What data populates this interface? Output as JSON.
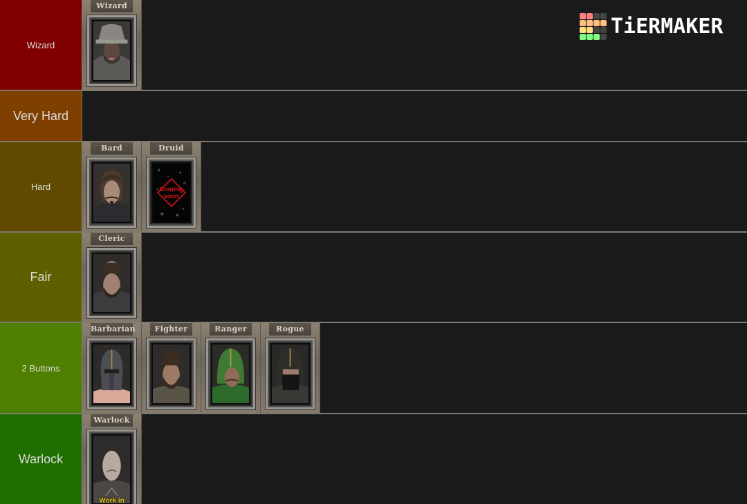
{
  "logo": {
    "text": "TiERMAKER",
    "grid_colors": [
      "#ff7f7f",
      "#ff7f7f",
      "#444444",
      "#444444",
      "#ffbf7f",
      "#ffbf7f",
      "#ffbf7f",
      "#ffbf7f",
      "#ffdf7f",
      "#ffdf7f",
      "#444444",
      "#444444",
      "#7fff7f",
      "#7fff7f",
      "#7fff7f",
      "#444444"
    ]
  },
  "tiers": [
    {
      "label": "Wizard",
      "color": "#800000",
      "items": [
        {
          "name": "Wizard",
          "portrait": "wizard"
        }
      ]
    },
    {
      "label": "Very Hard",
      "color": "#7f3f00",
      "items": []
    },
    {
      "label": "Hard",
      "color": "#5f4a00",
      "items": [
        {
          "name": "Bard",
          "portrait": "bard"
        },
        {
          "name": "Druid",
          "portrait": "coming-soon",
          "overlay_text": "Coming soon"
        }
      ]
    },
    {
      "label": "Fair",
      "color": "#5f5f00",
      "items": [
        {
          "name": "Cleric",
          "portrait": "cleric"
        }
      ]
    },
    {
      "label": "2 Buttons",
      "color": "#4f7f00",
      "items": [
        {
          "name": "Barbarian",
          "portrait": "barbarian"
        },
        {
          "name": "Fighter",
          "portrait": "fighter"
        },
        {
          "name": "Ranger",
          "portrait": "ranger"
        },
        {
          "name": "Rogue",
          "portrait": "rogue"
        }
      ]
    },
    {
      "label": "Warlock",
      "color": "#1f6f00",
      "items": [
        {
          "name": "Warlock",
          "portrait": "warlock",
          "overlay_text": "Work in"
        }
      ]
    }
  ]
}
